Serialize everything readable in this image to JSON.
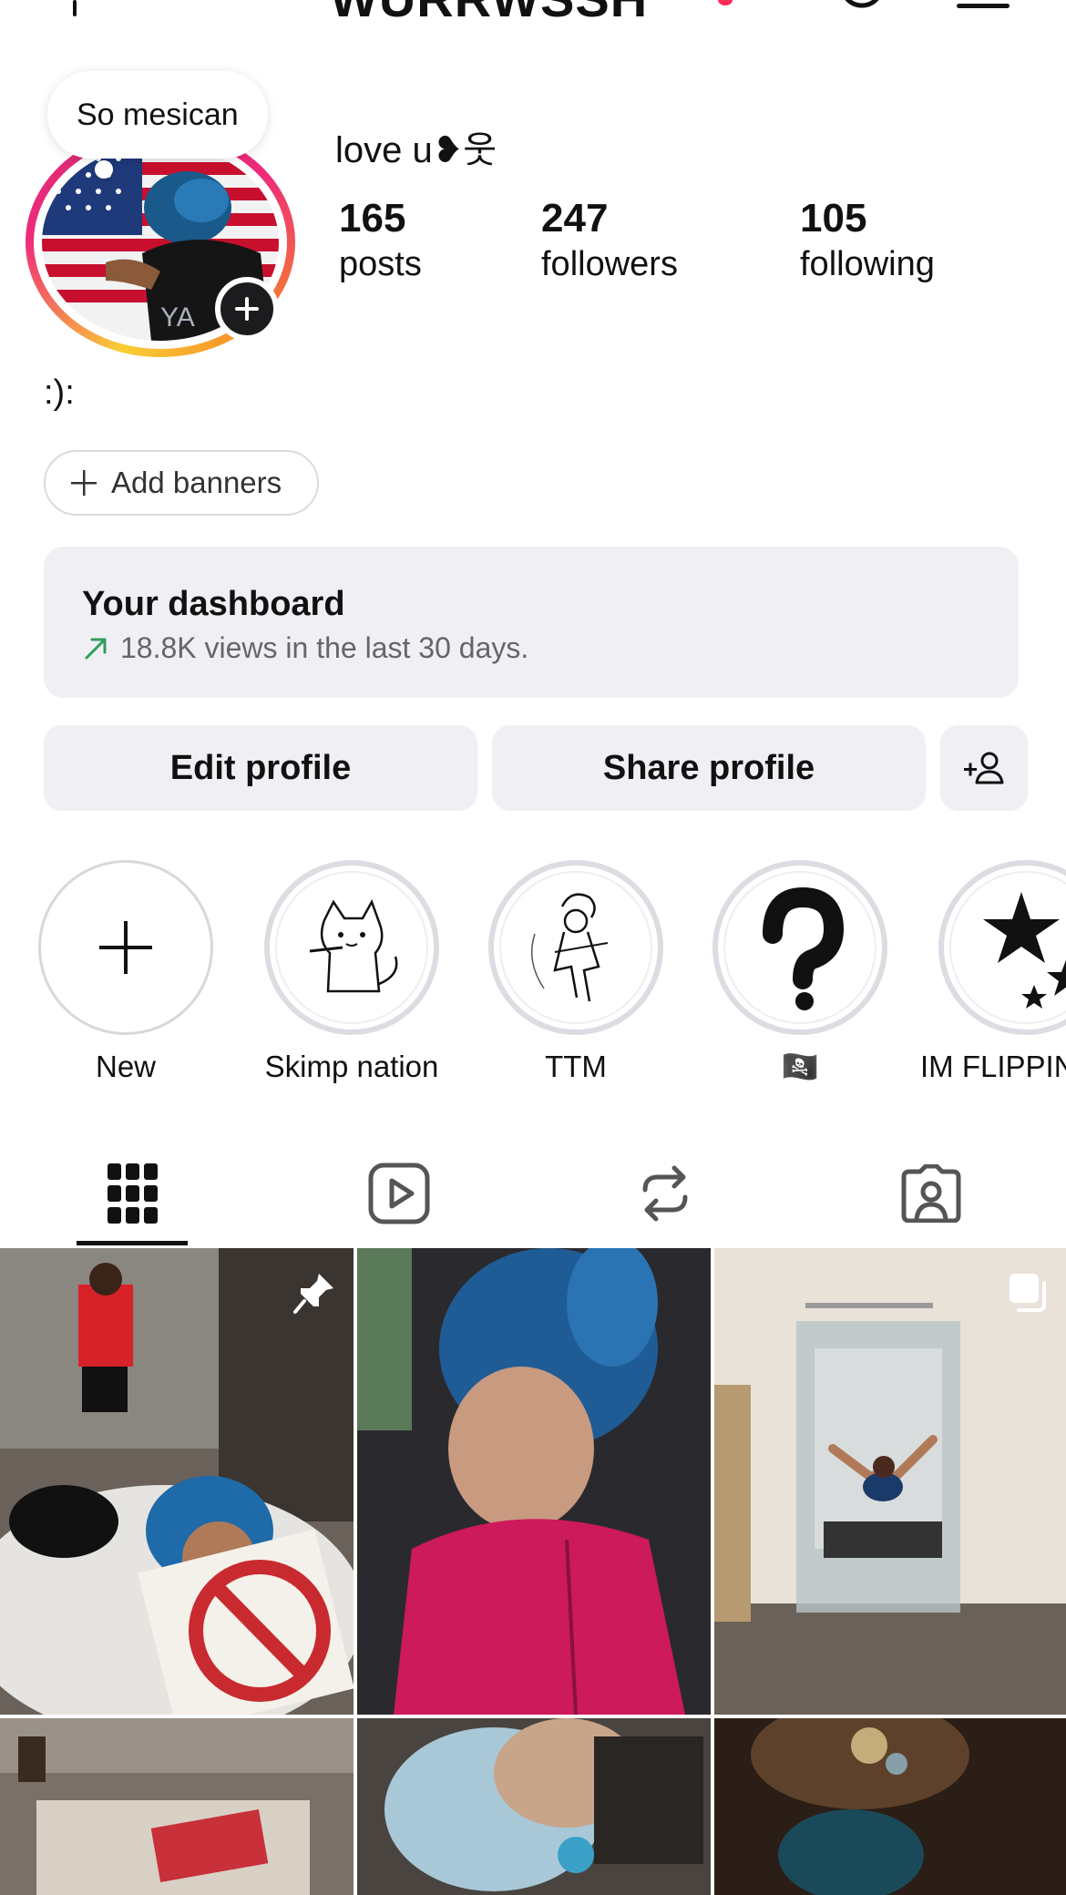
{
  "header": {
    "username": "WURRWSSH"
  },
  "note": {
    "text": "So mesican"
  },
  "profile": {
    "display_name": "love u❥웃",
    "bio": ":):"
  },
  "stats": [
    {
      "count": "165",
      "label": "posts"
    },
    {
      "count": "247",
      "label": "followers"
    },
    {
      "count": "105",
      "label": "following"
    }
  ],
  "banner_button": {
    "label": "Add banners"
  },
  "dashboard": {
    "title": "Your dashboard",
    "subtitle": "18.8K views in the last 30 days."
  },
  "actions": {
    "edit_label": "Edit profile",
    "share_label": "Share profile"
  },
  "highlights": [
    {
      "label": "New",
      "icon": "plus-icon"
    },
    {
      "label": "Skimp nation",
      "icon": "cat-sketch"
    },
    {
      "label": "TTM",
      "icon": "jester-sketch"
    },
    {
      "label": "🏴‍☠️",
      "icon": "spiral-question-mark"
    },
    {
      "label": "IM FLIPPIN",
      "icon": "stars"
    }
  ],
  "tabs": [
    {
      "name": "posts-grid",
      "icon": "grid-icon",
      "active": true
    },
    {
      "name": "reels",
      "icon": "reels-icon",
      "active": false
    },
    {
      "name": "reposts",
      "icon": "repost-icon",
      "active": false
    },
    {
      "name": "tagged",
      "icon": "tagged-icon",
      "active": false
    }
  ],
  "colors": {
    "accent_ring": [
      "#f9ce34",
      "#ee2a7b",
      "#f58529"
    ],
    "button_bg": "#efeff4",
    "trend_arrow": "#2e9e5a"
  }
}
